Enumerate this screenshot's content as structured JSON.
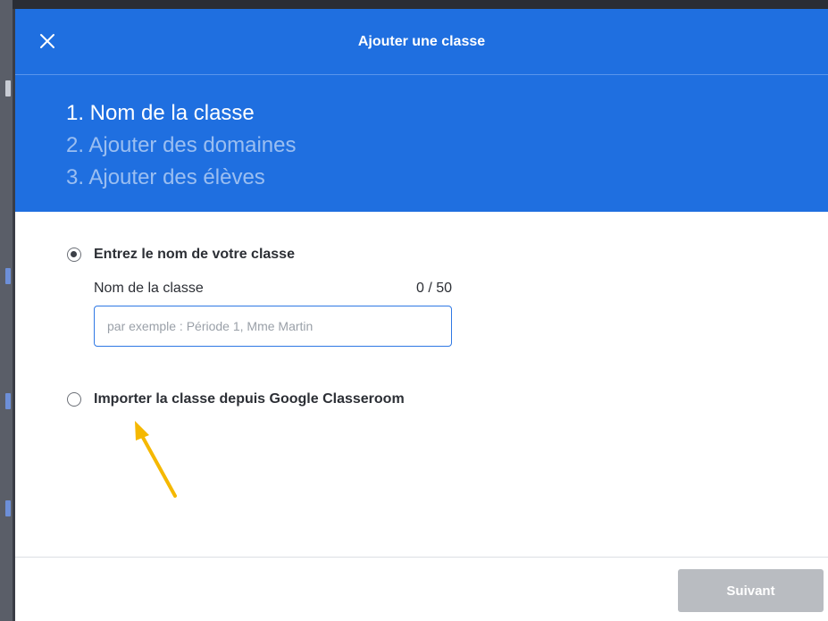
{
  "modal": {
    "title": "Ajouter une classe",
    "close_icon": "close-icon"
  },
  "steps": [
    {
      "label": "1. Nom de la classe",
      "active": true
    },
    {
      "label": "2. Ajouter des domaines",
      "active": false
    },
    {
      "label": "3. Ajouter des élèves",
      "active": false
    }
  ],
  "options": {
    "manual": {
      "label": "Entrez le nom de votre classe",
      "selected": true
    },
    "google": {
      "label": "Importer la classe depuis Google Classeroom",
      "selected": false
    }
  },
  "class_name_field": {
    "label": "Nom de la classe",
    "counter": "0 / 50",
    "value": "",
    "placeholder": "par exemple : Période 1, Mme Martin"
  },
  "footer": {
    "next_label": "Suivant",
    "next_enabled": false
  },
  "colors": {
    "header_blue": "#1f6fe0",
    "input_border": "#2f78e4",
    "disabled_button": "#b9bcc1",
    "annotation_arrow": "#f5b800"
  }
}
